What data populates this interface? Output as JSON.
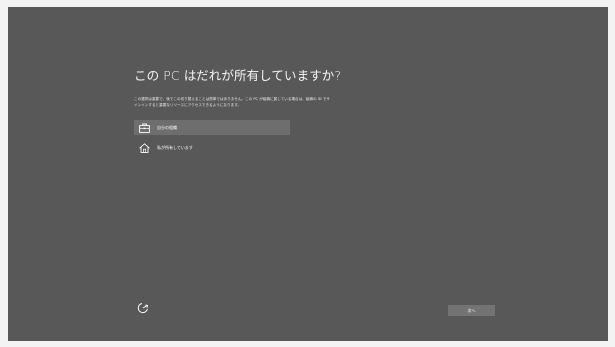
{
  "colors": {
    "background": "#585858",
    "selected_option": "#6e6e6e",
    "button": "#737373",
    "text": "#ffffff"
  },
  "title": "この PC はだれが所有していますか?",
  "description": {
    "line1": "この選択は重要で、後でこの切り替えることは簡単ではありません。この PC が組織に属している場合は、組織の ID でサ",
    "line2": "インインすると重要なリソースにアクセスできるようになります。"
  },
  "options": [
    {
      "label": "自分の組織",
      "icon": "briefcase-icon",
      "selected": true
    },
    {
      "label": "私が所有しています",
      "icon": "home-icon",
      "selected": false
    }
  ],
  "accessibility": {
    "icon": "ease-of-access-icon"
  },
  "next_button": {
    "label": "次へ"
  }
}
